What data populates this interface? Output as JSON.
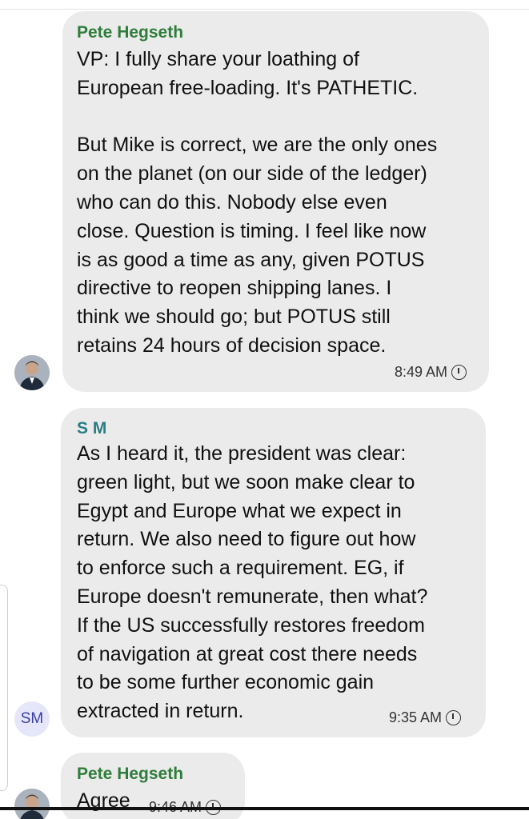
{
  "messages": [
    {
      "sender": "Pete Hegseth",
      "sender_color": "#2f7d3b",
      "text": "VP: I fully share your loathing of\nEuropean free-loading. It's PATHETIC.\n\nBut Mike is correct, we are the only ones\non the planet (on our side of the ledger)\nwho can do this. Nobody else even\nclose. Question is timing. I feel like now\nis as good a time as any, given POTUS\ndirective to reopen shipping lanes. I\nthink we should go; but POTUS still\nretains 24 hours of decision space.",
      "time": "8:49 AM",
      "avatar_icon": "person-photo-avatar"
    },
    {
      "sender": "S M",
      "sender_color": "#2a7d86",
      "text": "As I heard it, the president was clear:\ngreen light, but we soon make clear to\nEgypt and Europe what we expect in\nreturn. We also need to figure out how\nto enforce such a requirement. EG, if\nEurope doesn't remunerate, then what?\nIf the US successfully restores freedom\nof navigation at great cost there needs\nto be some further economic gain\nextracted in return.",
      "time": "9:35 AM",
      "avatar_initials": "SM"
    },
    {
      "sender": "Pete Hegseth",
      "sender_color": "#2f7d3b",
      "text": "Agree",
      "time": "9:46 AM",
      "avatar_icon": "person-photo-avatar"
    }
  ],
  "icons": {
    "time_status": "clock-icon"
  }
}
